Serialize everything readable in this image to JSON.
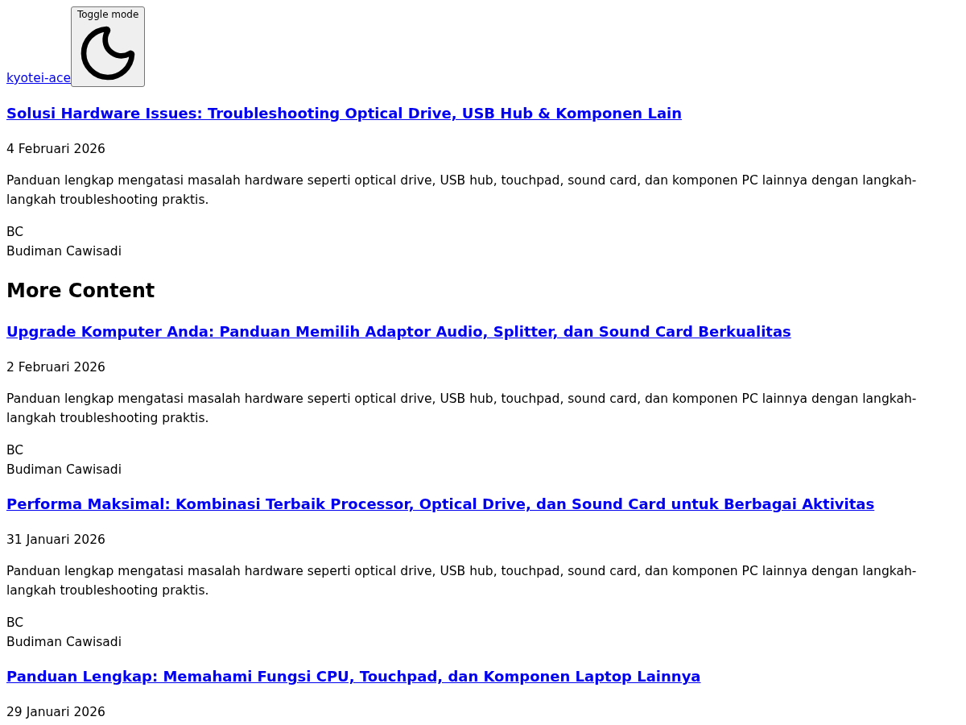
{
  "header": {
    "site_link": "kyotei-ace",
    "toggle_button": {
      "label": "Toggle mode"
    }
  },
  "featured_post": {
    "title": "Solusi Hardware Issues: Troubleshooting Optical Drive, USB Hub & Komponen Lain",
    "date": "4 Februari 2026",
    "excerpt": "Panduan lengkap mengatasi masalah hardware seperti optical drive, USB hub, touchpad, sound card, dan komponen PC lainnya dengan langkah-langkah troubleshooting praktis.",
    "author": {
      "initials": "BC",
      "name": "Budiman Cawisadi"
    }
  },
  "more_content": {
    "heading": "More Content",
    "posts": [
      {
        "title": "Upgrade Komputer Anda: Panduan Memilih Adaptor Audio, Splitter, dan Sound Card Berkualitas",
        "date": "2 Februari 2026",
        "excerpt": "Panduan lengkap mengatasi masalah hardware seperti optical drive, USB hub, touchpad, sound card, dan komponen PC lainnya dengan langkah-langkah troubleshooting praktis.",
        "author": {
          "initials": "BC",
          "name": "Budiman Cawisadi"
        }
      },
      {
        "title": "Performa Maksimal: Kombinasi Terbaik Processor, Optical Drive, dan Sound Card untuk Berbagai Aktivitas",
        "date": "31 Januari 2026",
        "excerpt": "Panduan lengkap mengatasi masalah hardware seperti optical drive, USB hub, touchpad, sound card, dan komponen PC lainnya dengan langkah-langkah troubleshooting praktis.",
        "author": {
          "initials": "BC",
          "name": "Budiman Cawisadi"
        }
      },
      {
        "title": "Panduan Lengkap: Memahami Fungsi CPU, Touchpad, dan Komponen Laptop Lainnya",
        "date": "29 Januari 2026"
      }
    ]
  }
}
